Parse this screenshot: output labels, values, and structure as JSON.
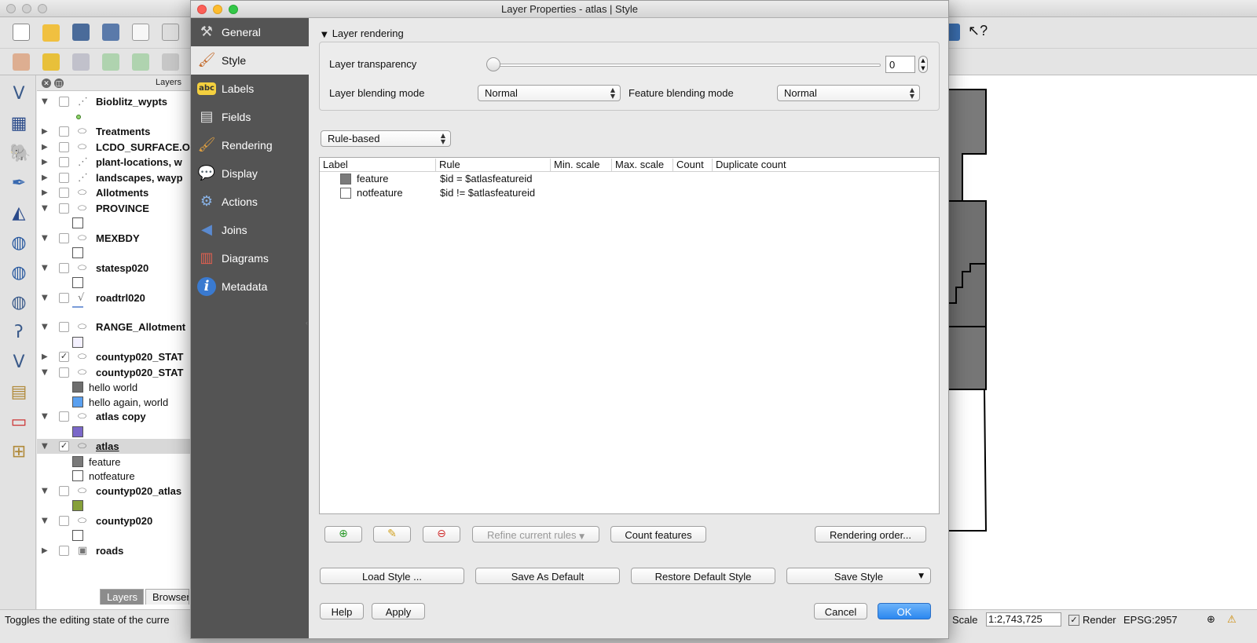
{
  "main_window": {
    "layers_panel": {
      "title": "Layers",
      "tabs": [
        {
          "label": "Layers",
          "active": true
        },
        {
          "label": "Browser",
          "active": false
        }
      ],
      "rows": [
        {
          "kind": "layer",
          "name": "Bioblitz_wypts",
          "expanded": true,
          "checked": false,
          "icon": "point-layer-icon"
        },
        {
          "kind": "legend-dot",
          "color": "#8fd46b"
        },
        {
          "kind": "layer",
          "name": "Treatments",
          "expanded": false,
          "checked": false,
          "icon": "polygon-layer-icon"
        },
        {
          "kind": "layer",
          "name": "LCDO_SURFACE.O",
          "expanded": false,
          "checked": false,
          "icon": "polygon-layer-icon"
        },
        {
          "kind": "layer",
          "name": "plant-locations, w",
          "expanded": false,
          "checked": false,
          "icon": "point-layer-icon"
        },
        {
          "kind": "layer",
          "name": "landscapes, wayp",
          "expanded": false,
          "checked": false,
          "icon": "point-layer-icon"
        },
        {
          "kind": "layer",
          "name": "Allotments",
          "expanded": false,
          "checked": false,
          "icon": "polygon-layer-icon"
        },
        {
          "kind": "layer",
          "name": "PROVINCE",
          "expanded": true,
          "checked": false,
          "icon": "polygon-layer-icon"
        },
        {
          "kind": "legend",
          "color": "#ffffff",
          "label": ""
        },
        {
          "kind": "layer",
          "name": "MEXBDY",
          "expanded": true,
          "checked": false,
          "icon": "polygon-layer-icon"
        },
        {
          "kind": "legend",
          "color": "#ffffff",
          "label": ""
        },
        {
          "kind": "layer",
          "name": "statesp020",
          "expanded": true,
          "checked": false,
          "icon": "polygon-layer-icon"
        },
        {
          "kind": "legend",
          "color": "#ffffff",
          "label": ""
        },
        {
          "kind": "layer",
          "name": "roadtrl020",
          "expanded": true,
          "checked": false,
          "icon": "line-layer-icon"
        },
        {
          "kind": "legend-line",
          "color": "#7a9bd8"
        },
        {
          "kind": "layer",
          "name": "RANGE_Allotment",
          "expanded": true,
          "checked": false,
          "icon": "polygon-layer-icon"
        },
        {
          "kind": "legend",
          "color": "#f4f1ff",
          "label": ""
        },
        {
          "kind": "layer",
          "name": "countyp020_STAT",
          "expanded": false,
          "checked": true,
          "icon": "polygon-layer-icon"
        },
        {
          "kind": "layer",
          "name": "countyp020_STAT",
          "expanded": true,
          "checked": false,
          "icon": "polygon-layer-icon"
        },
        {
          "kind": "legend",
          "color": "#6e6e6e",
          "label": "hello world"
        },
        {
          "kind": "legend",
          "color": "#5aa0f0",
          "label": "hello again, world"
        },
        {
          "kind": "layer",
          "name": "atlas copy",
          "expanded": true,
          "checked": false,
          "icon": "polygon-layer-icon"
        },
        {
          "kind": "legend",
          "color": "#7b68c9",
          "label": ""
        },
        {
          "kind": "layer",
          "name": "atlas",
          "expanded": true,
          "checked": true,
          "icon": "polygon-layer-icon",
          "selected": true
        },
        {
          "kind": "legend",
          "color": "#7a7a7a",
          "label": "feature"
        },
        {
          "kind": "legend",
          "color": "#ffffff",
          "label": "notfeature"
        },
        {
          "kind": "layer",
          "name": "countyp020_atlas",
          "expanded": true,
          "checked": false,
          "icon": "polygon-layer-icon"
        },
        {
          "kind": "legend",
          "color": "#86a03a",
          "label": ""
        },
        {
          "kind": "layer",
          "name": "countyp020",
          "expanded": true,
          "checked": false,
          "icon": "polygon-layer-icon"
        },
        {
          "kind": "legend",
          "color": "#ffffff",
          "label": ""
        },
        {
          "kind": "layer",
          "name": "roads",
          "expanded": false,
          "checked": false,
          "icon": "raster-layer-icon"
        }
      ]
    },
    "status_bar": {
      "message": "Toggles the editing state of the curre",
      "scale_label": "Scale",
      "scale_value": "1:2,743,725",
      "render_label": "Render",
      "crs": "EPSG:2957"
    }
  },
  "dialog": {
    "title": "Layer Properties - atlas | Style",
    "sidebar": [
      {
        "label": "General",
        "icon": "general-tools-icon",
        "active": false
      },
      {
        "label": "Style",
        "icon": "style-brush-icon",
        "active": true
      },
      {
        "label": "Labels",
        "icon": "labels-abc-icon",
        "active": false
      },
      {
        "label": "Fields",
        "icon": "fields-table-icon",
        "active": false
      },
      {
        "label": "Rendering",
        "icon": "rendering-brush-icon",
        "active": false
      },
      {
        "label": "Display",
        "icon": "display-speech-bubble-icon",
        "active": false
      },
      {
        "label": "Actions",
        "icon": "actions-gear-icon",
        "active": false
      },
      {
        "label": "Joins",
        "icon": "joins-icon",
        "active": false
      },
      {
        "label": "Diagrams",
        "icon": "diagrams-icon",
        "active": false
      },
      {
        "label": "Metadata",
        "icon": "metadata-info-icon",
        "active": false
      }
    ],
    "layer_rendering": {
      "header": "Layer rendering",
      "transparency_label": "Layer transparency",
      "transparency_value": "0",
      "transparency_level": 0,
      "blending_label": "Layer blending mode",
      "blending_value": "Normal",
      "feature_blending_label": "Feature blending mode",
      "feature_blending_value": "Normal"
    },
    "renderer_type": "Rule-based",
    "rules_table": {
      "columns": [
        "Label",
        "Rule",
        "Min. scale",
        "Max. scale",
        "Count",
        "Duplicate count"
      ],
      "rows": [
        {
          "label": "feature",
          "rule": "$id = $atlasfeatureid",
          "color": "#7a7a7a"
        },
        {
          "label": "notfeature",
          "rule": "$id != $atlasfeatureid",
          "color": "#ffffff"
        }
      ]
    },
    "rule_buttons": {
      "add": "add-rule-icon",
      "edit": "edit-rule-icon",
      "remove": "remove-rule-icon",
      "refine": "Refine current rules",
      "count": "Count features",
      "order": "Rendering order..."
    },
    "style_buttons": {
      "load": "Load Style ...",
      "save_default": "Save As Default",
      "restore_default": "Restore Default Style",
      "save_style": "Save Style"
    },
    "footer": {
      "help": "Help",
      "apply": "Apply",
      "cancel": "Cancel",
      "ok": "OK"
    }
  }
}
